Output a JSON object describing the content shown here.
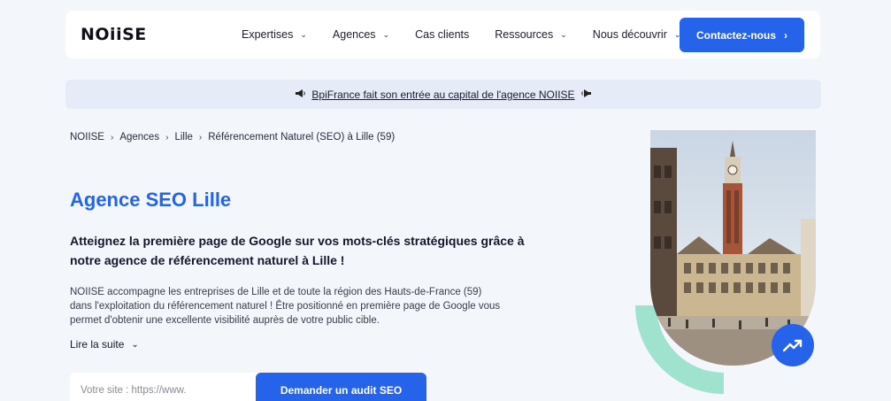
{
  "header": {
    "logo": "NOiiSE",
    "nav": [
      {
        "label": "Expertises",
        "has_dropdown": true
      },
      {
        "label": "Agences",
        "has_dropdown": true
      },
      {
        "label": "Cas clients",
        "has_dropdown": false
      },
      {
        "label": "Ressources",
        "has_dropdown": true
      },
      {
        "label": "Nous découvrir",
        "has_dropdown": true
      }
    ],
    "cta_label": "Contactez-nous",
    "cta_icon": "chevron-right-icon"
  },
  "announcement": {
    "text": "BpiFrance fait son entrée au capital de l'agence NOIISE",
    "icon": "megaphone-icon"
  },
  "breadcrumb": [
    "NOIISE",
    "Agences",
    "Lille",
    "Référencement Naturel (SEO) à Lille (59)"
  ],
  "main": {
    "title": "Agence SEO Lille",
    "subtitle": "Atteignez la première page de Google sur vos mots-clés stratégiques grâce à notre agence de référencement naturel à Lille !",
    "description": "NOIISE accompagne les entreprises de Lille et de toute la région des Hauts-de-France (59) dans l'exploitation du référencement naturel ! Être positionné en première page de Google vous permet d'obtenir une excellente visibilité auprès de votre public cible.",
    "read_more": "Lire la suite",
    "form": {
      "placeholder": "Votre site : https://www.",
      "button": "Demander un audit SEO"
    }
  },
  "colors": {
    "accent": "#2563eb",
    "background": "#f3f6fb",
    "banner": "#e6ecf7",
    "mint": "#9fe3cf"
  }
}
